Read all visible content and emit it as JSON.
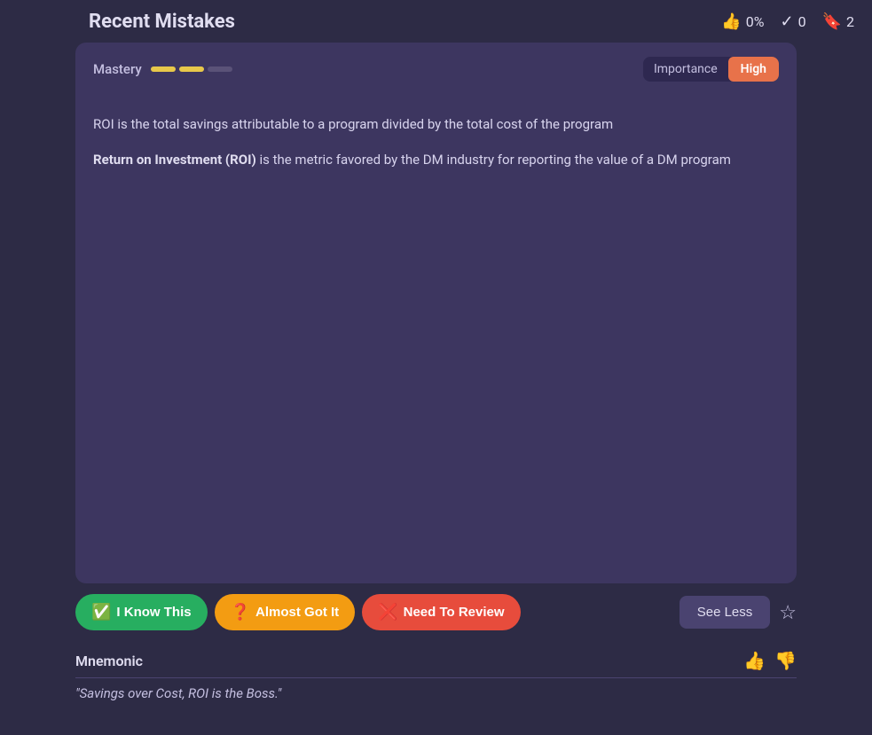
{
  "header": {
    "title": "Recent Mistakes",
    "stats": {
      "percentage": "0%",
      "check_count": "0",
      "bookmark_count": "2"
    }
  },
  "card": {
    "mastery": {
      "label": "Mastery",
      "segments": [
        {
          "filled": true
        },
        {
          "filled": true
        },
        {
          "filled": false
        }
      ]
    },
    "importance": {
      "label": "Importance",
      "badge": "High"
    },
    "content": {
      "line1": "ROI is the total savings attributable to a program divided by the total cost of the program",
      "line2_bold": "Return on Investment (ROI)",
      "line2_rest": " is the metric favored by the DM industry for reporting the value of a DM program"
    }
  },
  "action_buttons": {
    "know_label": "I Know This",
    "almost_label": "Almost Got It",
    "review_label": "Need To Review",
    "see_less_label": "See Less"
  },
  "mnemonic": {
    "title": "Mnemonic",
    "text": "\"Savings over Cost, ROI is the Boss.\""
  }
}
